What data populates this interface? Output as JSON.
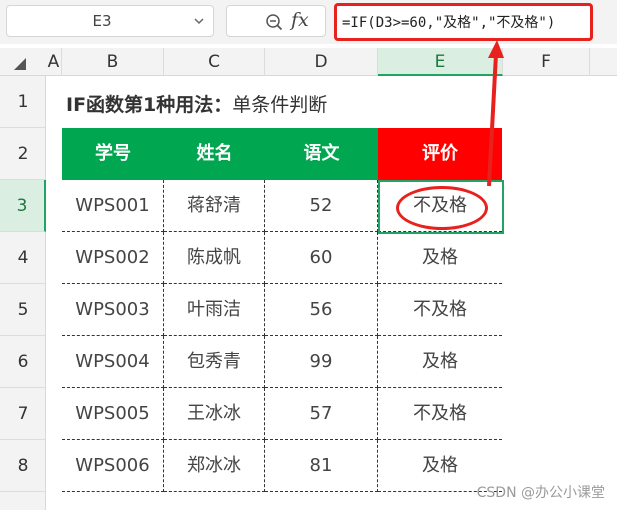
{
  "name_box": {
    "ref": "E3"
  },
  "formula_bar": {
    "fx_label": "fx",
    "formula": "=IF(D3>=60,\"及格\",\"不及格\")"
  },
  "column_headers": [
    "A",
    "B",
    "C",
    "D",
    "E",
    "F"
  ],
  "row_headers": [
    "1",
    "2",
    "3",
    "4",
    "5",
    "6",
    "7",
    "8"
  ],
  "selected": {
    "column": "E",
    "row": "3"
  },
  "sheet": {
    "title_bold": "IF函数第1种用法：",
    "title_rest": "单条件判断",
    "headers": [
      "学号",
      "姓名",
      "语文",
      "评价"
    ],
    "rows": [
      [
        "WPS001",
        "蒋舒清",
        "52",
        "不及格"
      ],
      [
        "WPS002",
        "陈成帆",
        "60",
        "及格"
      ],
      [
        "WPS003",
        "叶雨洁",
        "56",
        "不及格"
      ],
      [
        "WPS004",
        "包秀青",
        "99",
        "及格"
      ],
      [
        "WPS005",
        "王冰冰",
        "57",
        "不及格"
      ],
      [
        "WPS006",
        "郑冰冰",
        "81",
        "及格"
      ]
    ]
  },
  "colors": {
    "header_green": "#00a650",
    "header_red": "#ff0000",
    "annotation_red": "#e8201e",
    "selection_green": "#21a366"
  },
  "watermark": "CSDN @办公小课堂"
}
